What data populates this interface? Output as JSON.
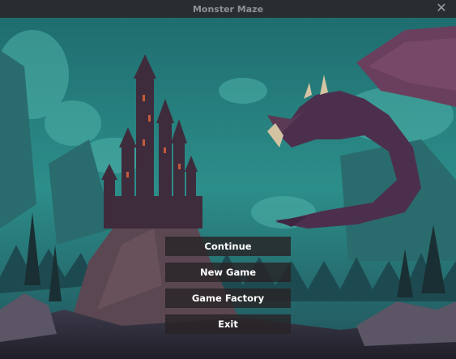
{
  "window": {
    "title": "Monster Maze",
    "close_symbol": "✕"
  },
  "scene": {
    "description_icon": "fantasy-castle-dragon-illustration",
    "sky_color": "#2f8e8a",
    "accent_dark": "#3b2b3d"
  },
  "menu": {
    "items": [
      {
        "label": "Continue"
      },
      {
        "label": "New Game"
      },
      {
        "label": "Game Factory"
      },
      {
        "label": "Exit"
      }
    ]
  }
}
